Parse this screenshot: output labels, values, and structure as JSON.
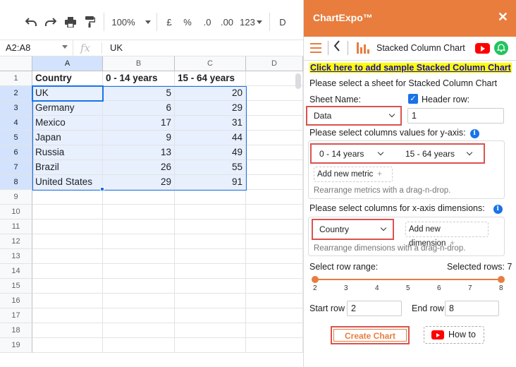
{
  "toolbar": {
    "zoom": "100%",
    "currency": "£",
    "percent": "%",
    "dec_decrease": ".0",
    "dec_increase": ".00",
    "more_formats": "123",
    "font_partial": "D"
  },
  "formula_bar": {
    "namebox": "A2:A8",
    "fx": "fx",
    "value": "UK"
  },
  "sheet": {
    "columns": [
      "A",
      "B",
      "C",
      "D"
    ],
    "row_numbers": [
      "1",
      "2",
      "3",
      "4",
      "5",
      "6",
      "7",
      "8",
      "9",
      "10",
      "11",
      "12",
      "13",
      "14",
      "15",
      "16",
      "17",
      "18",
      "19"
    ],
    "rows": [
      [
        "Country",
        "0 - 14 years",
        "15 - 64 years"
      ],
      [
        "UK",
        "5",
        "20"
      ],
      [
        "Germany",
        "6",
        "29"
      ],
      [
        "Mexico",
        "17",
        "31"
      ],
      [
        "Japan",
        "9",
        "44"
      ],
      [
        "Russia",
        "13",
        "49"
      ],
      [
        "Brazil",
        "26",
        "55"
      ],
      [
        "United States",
        "29",
        "91"
      ]
    ]
  },
  "panel": {
    "title": "ChartExpo™",
    "close": "✕",
    "chart_name": "Stacked Column Chart",
    "sample_link": "Click here to add sample Stacked Column Chart",
    "select_sheet_text": "Please select a sheet for Stacked Column Chart",
    "sheet_name_label": "Sheet Name:",
    "header_row_label": "Header row:",
    "sheet_value": "Data",
    "header_row_value": "1",
    "y_axis_label": "Please select columns values for y-axis:",
    "metric_1": "0 - 14 years",
    "metric_2": "15 - 64 years",
    "add_metric": "Add new metric",
    "metric_hint": "Rearrange metrics with a drag-n-drop.",
    "x_axis_label": "Please select columns for x-axis dimensions:",
    "dimension_1": "Country",
    "add_dimension": "Add new dimension",
    "dimension_hint": "Rearrange dimensions with a drag-n-drop.",
    "row_range_label": "Select row range:",
    "selected_rows_label": "Selected rows: 7",
    "ticks": [
      "2",
      "3",
      "4",
      "5",
      "6",
      "7",
      "8"
    ],
    "range_min": 2,
    "range_max": 8,
    "range_start": 2,
    "range_end": 8,
    "start_row_label": "Start row",
    "start_row_value": "2",
    "end_row_label": "End row",
    "end_row_value": "8",
    "create_chart": "Create Chart",
    "how_to": "How to"
  }
}
